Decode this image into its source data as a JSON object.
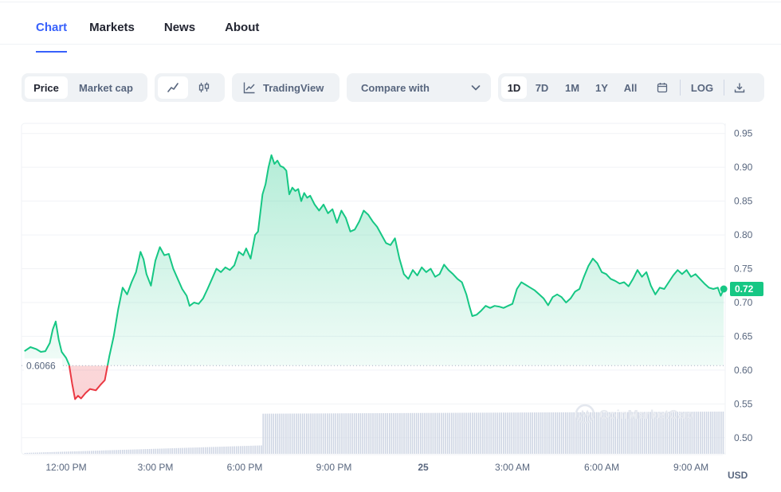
{
  "tabs": [
    {
      "label": "Chart",
      "active": true
    },
    {
      "label": "Markets",
      "active": false
    },
    {
      "label": "News",
      "active": false
    },
    {
      "label": "About",
      "active": false
    }
  ],
  "toolbar": {
    "price_label": "Price",
    "market_cap_label": "Market cap",
    "tradingview_label": "TradingView",
    "compare_label": "Compare with",
    "ranges": [
      "1D",
      "7D",
      "1M",
      "1Y",
      "All"
    ],
    "active_range": "1D",
    "log_label": "LOG"
  },
  "chart_data": {
    "type": "area",
    "currency": "USD",
    "open_price_label": "0.6066",
    "open_price": 0.6066,
    "current_price_label": "0.72",
    "current_price": 0.72,
    "y_ticks": [
      "0.95",
      "0.90",
      "0.85",
      "0.80",
      "0.75",
      "0.70",
      "0.65",
      "0.60",
      "0.55",
      "0.50"
    ],
    "ylim": [
      0.475,
      0.965
    ],
    "x_ticks": [
      "12:00 PM",
      "3:00 PM",
      "6:00 PM",
      "9:00 PM",
      "25",
      "3:00 AM",
      "6:00 AM",
      "9:00 AM"
    ],
    "x_tick_hours": [
      12,
      15,
      18,
      21,
      24,
      27,
      30,
      33
    ],
    "xlim": [
      10.5,
      34.15
    ],
    "up_color": "#16c784",
    "down_color": "#ea3943",
    "watermark": "CoinMarketCap",
    "series": [
      {
        "values": [
          [
            10.6,
            0.628
          ],
          [
            10.8,
            0.634
          ],
          [
            11.0,
            0.631
          ],
          [
            11.15,
            0.627
          ],
          [
            11.3,
            0.628
          ],
          [
            11.45,
            0.64
          ],
          [
            11.55,
            0.66
          ],
          [
            11.65,
            0.672
          ],
          [
            11.75,
            0.645
          ],
          [
            11.85,
            0.627
          ],
          [
            12.0,
            0.618
          ],
          [
            12.1,
            0.608
          ],
          [
            12.2,
            0.58
          ],
          [
            12.3,
            0.557
          ],
          [
            12.4,
            0.562
          ],
          [
            12.5,
            0.558
          ],
          [
            12.65,
            0.566
          ],
          [
            12.8,
            0.572
          ],
          [
            13.0,
            0.57
          ],
          [
            13.15,
            0.578
          ],
          [
            13.3,
            0.585
          ],
          [
            13.45,
            0.62
          ],
          [
            13.6,
            0.65
          ],
          [
            13.75,
            0.69
          ],
          [
            13.9,
            0.722
          ],
          [
            14.05,
            0.712
          ],
          [
            14.2,
            0.73
          ],
          [
            14.35,
            0.745
          ],
          [
            14.5,
            0.775
          ],
          [
            14.6,
            0.764
          ],
          [
            14.7,
            0.742
          ],
          [
            14.85,
            0.725
          ],
          [
            15.0,
            0.762
          ],
          [
            15.15,
            0.782
          ],
          [
            15.3,
            0.77
          ],
          [
            15.45,
            0.772
          ],
          [
            15.6,
            0.75
          ],
          [
            15.75,
            0.735
          ],
          [
            15.9,
            0.72
          ],
          [
            16.05,
            0.71
          ],
          [
            16.15,
            0.695
          ],
          [
            16.3,
            0.7
          ],
          [
            16.45,
            0.698
          ],
          [
            16.6,
            0.706
          ],
          [
            16.75,
            0.72
          ],
          [
            16.9,
            0.735
          ],
          [
            17.05,
            0.75
          ],
          [
            17.2,
            0.745
          ],
          [
            17.35,
            0.752
          ],
          [
            17.5,
            0.748
          ],
          [
            17.65,
            0.755
          ],
          [
            17.8,
            0.775
          ],
          [
            17.95,
            0.77
          ],
          [
            18.05,
            0.78
          ],
          [
            18.2,
            0.765
          ],
          [
            18.35,
            0.8
          ],
          [
            18.45,
            0.805
          ],
          [
            18.6,
            0.86
          ],
          [
            18.7,
            0.875
          ],
          [
            18.8,
            0.9
          ],
          [
            18.9,
            0.918
          ],
          [
            19.0,
            0.905
          ],
          [
            19.1,
            0.91
          ],
          [
            19.2,
            0.902
          ],
          [
            19.3,
            0.9
          ],
          [
            19.4,
            0.895
          ],
          [
            19.5,
            0.86
          ],
          [
            19.6,
            0.87
          ],
          [
            19.7,
            0.865
          ],
          [
            19.8,
            0.868
          ],
          [
            19.9,
            0.85
          ],
          [
            20.0,
            0.862
          ],
          [
            20.1,
            0.855
          ],
          [
            20.2,
            0.858
          ],
          [
            20.35,
            0.845
          ],
          [
            20.5,
            0.836
          ],
          [
            20.65,
            0.845
          ],
          [
            20.8,
            0.832
          ],
          [
            20.95,
            0.838
          ],
          [
            21.1,
            0.818
          ],
          [
            21.25,
            0.836
          ],
          [
            21.4,
            0.825
          ],
          [
            21.55,
            0.805
          ],
          [
            21.7,
            0.808
          ],
          [
            21.85,
            0.82
          ],
          [
            22.0,
            0.836
          ],
          [
            22.15,
            0.83
          ],
          [
            22.3,
            0.82
          ],
          [
            22.45,
            0.812
          ],
          [
            22.6,
            0.8
          ],
          [
            22.75,
            0.788
          ],
          [
            22.9,
            0.785
          ],
          [
            23.05,
            0.795
          ],
          [
            23.2,
            0.765
          ],
          [
            23.35,
            0.742
          ],
          [
            23.5,
            0.735
          ],
          [
            23.65,
            0.748
          ],
          [
            23.8,
            0.74
          ],
          [
            23.95,
            0.752
          ],
          [
            24.1,
            0.745
          ],
          [
            24.25,
            0.75
          ],
          [
            24.4,
            0.738
          ],
          [
            24.55,
            0.742
          ],
          [
            24.7,
            0.756
          ],
          [
            24.85,
            0.748
          ],
          [
            25.0,
            0.742
          ],
          [
            25.15,
            0.735
          ],
          [
            25.3,
            0.73
          ],
          [
            25.45,
            0.712
          ],
          [
            25.55,
            0.695
          ],
          [
            25.65,
            0.68
          ],
          [
            25.8,
            0.682
          ],
          [
            25.95,
            0.688
          ],
          [
            26.1,
            0.695
          ],
          [
            26.25,
            0.692
          ],
          [
            26.4,
            0.695
          ],
          [
            26.55,
            0.694
          ],
          [
            26.7,
            0.692
          ],
          [
            26.85,
            0.695
          ],
          [
            27.0,
            0.698
          ],
          [
            27.15,
            0.72
          ],
          [
            27.3,
            0.73
          ],
          [
            27.45,
            0.726
          ],
          [
            27.6,
            0.722
          ],
          [
            27.75,
            0.718
          ],
          [
            27.9,
            0.712
          ],
          [
            28.05,
            0.706
          ],
          [
            28.2,
            0.696
          ],
          [
            28.35,
            0.708
          ],
          [
            28.5,
            0.712
          ],
          [
            28.65,
            0.708
          ],
          [
            28.8,
            0.7
          ],
          [
            28.95,
            0.706
          ],
          [
            29.1,
            0.716
          ],
          [
            29.25,
            0.72
          ],
          [
            29.4,
            0.738
          ],
          [
            29.55,
            0.754
          ],
          [
            29.7,
            0.765
          ],
          [
            29.85,
            0.758
          ],
          [
            30.0,
            0.745
          ],
          [
            30.15,
            0.742
          ],
          [
            30.3,
            0.735
          ],
          [
            30.45,
            0.732
          ],
          [
            30.6,
            0.728
          ],
          [
            30.75,
            0.73
          ],
          [
            30.9,
            0.724
          ],
          [
            31.05,
            0.735
          ],
          [
            31.2,
            0.748
          ],
          [
            31.35,
            0.738
          ],
          [
            31.5,
            0.745
          ],
          [
            31.65,
            0.725
          ],
          [
            31.8,
            0.712
          ],
          [
            31.95,
            0.722
          ],
          [
            32.1,
            0.72
          ],
          [
            32.25,
            0.73
          ],
          [
            32.4,
            0.74
          ],
          [
            32.55,
            0.748
          ],
          [
            32.7,
            0.742
          ],
          [
            32.85,
            0.748
          ],
          [
            33.0,
            0.738
          ],
          [
            33.15,
            0.742
          ],
          [
            33.3,
            0.735
          ],
          [
            33.45,
            0.728
          ],
          [
            33.6,
            0.722
          ],
          [
            33.75,
            0.72
          ],
          [
            33.9,
            0.722
          ],
          [
            34.0,
            0.71
          ],
          [
            34.1,
            0.72
          ]
        ]
      }
    ],
    "volume_relative": {
      "segments": [
        {
          "from_hour": 10.6,
          "to_hour": 18.6,
          "start": 0.02,
          "end": 0.2
        },
        {
          "from_hour": 18.6,
          "to_hour": 34.1,
          "start": 0.95,
          "end": 1.0
        }
      ]
    }
  }
}
